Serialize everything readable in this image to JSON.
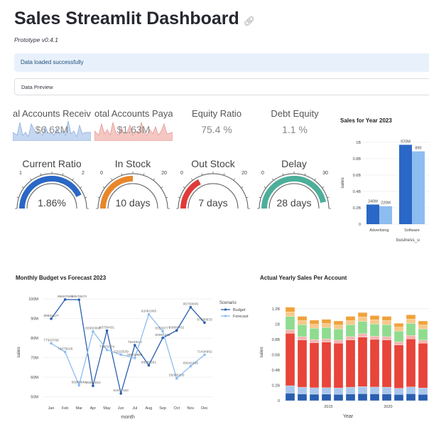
{
  "header": {
    "title": "Sales Streamlit Dashboard",
    "link_icon": "link-icon",
    "version": "Prototype v0.4.1"
  },
  "alert": {
    "text": "Data loaded successfully"
  },
  "expander": {
    "label": "Data Preview"
  },
  "kpis": [
    {
      "label": "al Accounts Receival",
      "value": "$6.62M"
    },
    {
      "label": "otal Accounts Payabl",
      "value": "$1.63M"
    },
    {
      "label": "Equity Ratio",
      "value": "75.4 %"
    },
    {
      "label": "Debt Equity",
      "value": "1.1 %"
    }
  ],
  "gauges": [
    {
      "label": "Current Ratio",
      "value": "1.86%",
      "value_num": 1.86,
      "min": "1",
      "max": "2",
      "min_num": 1,
      "max_num": 2,
      "color": "#2a67c6"
    },
    {
      "label": "In Stock",
      "value": "10 days",
      "value_num": 10,
      "min": "0",
      "max": "20",
      "min_num": 0,
      "max_num": 20,
      "color": "#e9862a"
    },
    {
      "label": "Out Stock",
      "value": "7 days",
      "value_num": 7,
      "min": "0",
      "max": "20",
      "min_num": 0,
      "max_num": 20,
      "color": "#e03a3a"
    },
    {
      "label": "Delay",
      "value": "28 days",
      "value_num": 28,
      "min": "0",
      "max": "30",
      "min_num": 0,
      "max_num": 30,
      "color": "#4caf9a"
    }
  ],
  "chart_data": [
    {
      "type": "bar",
      "title": "Sales for Year 2023",
      "ylabel": "sales",
      "xlabel": "business_u",
      "ylim": [
        0,
        1000000000
      ],
      "yticks": [
        "0",
        "0.2B",
        "0.4B",
        "0.6B",
        "0.8B",
        "1B"
      ],
      "categories": [
        "Advertising",
        "Software"
      ],
      "series": [
        {
          "values": [
            240000000,
            970000000
          ],
          "labels": [
            "240M",
            "970M"
          ],
          "color": "#2a67c6"
        },
        {
          "values": [
            220000000,
            890000000
          ],
          "labels": [
            "220M",
            "890"
          ],
          "color": "#8dbdf0"
        }
      ]
    },
    {
      "type": "line",
      "title": "Monthly Budget vs Forecast 2023",
      "xlabel": "month",
      "ylabel": "sales",
      "ylim": [
        48000000,
        100000000
      ],
      "yticks": [
        "50M",
        "60M",
        "70M",
        "80M",
        "90M",
        "100M"
      ],
      "legend_title": "Scenario",
      "categories": [
        "Jan",
        "Feb",
        "Mar",
        "Apr",
        "May",
        "Jun",
        "Jul",
        "Aug",
        "Sep",
        "Oct",
        "Nov",
        "Dec"
      ],
      "series": [
        {
          "name": "Budget",
          "color": "#2a5fb0",
          "values": [
            89862127,
            99687890,
            99578570,
            55591910,
            83758431,
            51677163,
            76348422,
            66085291,
            80081332,
            83880432,
            95750606,
            87880633
          ],
          "labels": [
            "89862127",
            "99687890",
            "99578570",
            "55591910",
            "83758431",
            "51677163",
            "763484 2",
            "66085291",
            "80081332",
            "83880432",
            "95750606",
            "87880633"
          ]
        },
        {
          "name": "Forecast",
          "color": "#8dbdf0",
          "values": [
            77303768,
            72875628,
            55880884,
            83382699,
            73975474,
            71515539,
            69833988,
            92091905,
            83539777,
            59385200,
            65641695,
            71434962
          ],
          "labels": [
            "77303768",
            "72875628",
            "55880884",
            "83382699",
            "73975474",
            "71515539",
            "69833988",
            "92091905",
            "83539777",
            "59385200",
            "65641695",
            "71434962"
          ]
        }
      ]
    },
    {
      "type": "bar",
      "title": "Actual Yearly Sales Per Account",
      "xlabel": "Year",
      "ylabel": "sales",
      "ylim": [
        0,
        1300000000
      ],
      "yticks": [
        "0",
        "0.2B",
        "0.4B",
        "0.6B",
        "0.8B",
        "1B",
        "1.2B"
      ],
      "xticks": [
        "2015",
        "2020"
      ],
      "stacked": true,
      "totals": [
        1.22,
        1.1,
        1.05,
        1.06,
        1.04,
        1.1,
        1.15,
        1.11,
        1.1,
        1.01,
        1.12,
        1.04,
        1.08,
        1.05,
        1.14,
        1.2
      ]
    }
  ]
}
